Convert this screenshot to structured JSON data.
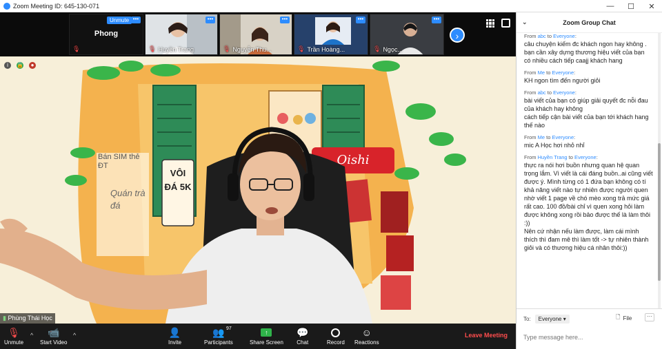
{
  "window": {
    "title": "Zoom Meeting ID: 645-130-071"
  },
  "window_controls": {
    "minimize": "—",
    "maximize": "☐",
    "close": "✕"
  },
  "gallery": {
    "participants": [
      {
        "name": "Phong",
        "unmute_label": "Unmute",
        "video_off": true
      },
      {
        "name": "Huyền Trang"
      },
      {
        "name": "Nguyễn Thu..."
      },
      {
        "name": "Trần Hoàng..."
      },
      {
        "name": "Ngọc..."
      }
    ],
    "more_label": "•••",
    "next_label": "›"
  },
  "main_video": {
    "speaker_name": "Phùng Thái Học",
    "signs": {
      "oishi": "Oishi",
      "voi_da": "VÔI ĐÁ 5K",
      "sim": "Bán SIM thẻ ĐT",
      "quan": "Quán trà đá"
    }
  },
  "toolbar": {
    "unmute": "Unmute",
    "start_video": "Start Video",
    "invite": "Invite",
    "participants": "Participants",
    "participants_count": "97",
    "share_screen": "Share Screen",
    "chat": "Chat",
    "record": "Record",
    "reactions": "Reactions",
    "leave": "Leave Meeting"
  },
  "chat": {
    "title": "Zoom Group Chat",
    "messages": [
      {
        "sender": "abc",
        "to": "Everyone",
        "lines": [
          "câu chuyện kiếm đc khách ngon hay không . bạn cần xây dựng thương hiệu viết của bạn",
          "có nhiều cách tiếp caajj khách hang"
        ]
      },
      {
        "sender": "Me",
        "to": "Everyone",
        "lines": [
          "KH ngon tìm đến người giỏi"
        ]
      },
      {
        "sender": "abc",
        "to": "Everyone",
        "lines": [
          "bài viết của bạn có giúp giải quyết đc nỗi đau của khách hay không",
          "cách tiếp cận bài viết của bạn tới khách hang thế nào"
        ]
      },
      {
        "sender": "Me",
        "to": "Everyone",
        "lines": [
          "mic A Học hơi nhỏ nhỉ"
        ]
      },
      {
        "sender": "Huyền Trang",
        "to": "Everyone",
        "lines": [
          "thực ra nói hơi buồn nhưng quan hệ quan trọng lắm. Vì viết là cái đáng buồn..ai cũng viết được ý. Mình từng có 1 đứa bạn không có tí khả năng viết nào tự nhiên được người quen nhờ viết 1 page về chó mèo xong trả mức giá rất cao. 100 đồ/bài chỉ vì quen xong hỏi làm được không xong rồi bảo được thế là làm thôi :))",
          "Nên cứ nhận nếu làm được, làm cái mình thích thì đam mê thì làm tốt -> tự nhiên thành giỏi và có thương hiệu cá nhân thôi:))"
        ]
      }
    ],
    "from_prefix": "From",
    "to_word": "to",
    "to_label": "To:",
    "to_value": "Everyone",
    "file_label": "File",
    "more_label": "···",
    "input_placeholder": "Type message here..."
  }
}
